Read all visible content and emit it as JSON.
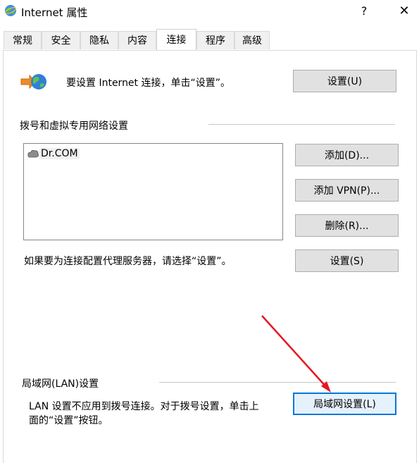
{
  "window": {
    "title": "Internet 属性",
    "help": "?",
    "close": "✕"
  },
  "tabs": [
    {
      "label": "常规"
    },
    {
      "label": "安全"
    },
    {
      "label": "隐私"
    },
    {
      "label": "内容"
    },
    {
      "label": "连接",
      "active": true
    },
    {
      "label": "程序"
    },
    {
      "label": "高级"
    }
  ],
  "setup": {
    "text": "要设置 Internet 连接，单击“设置”。",
    "button": "设置(U)"
  },
  "dialup": {
    "heading": "拨号和虚拟专用网络设置",
    "items": [
      {
        "name": "Dr.COM"
      }
    ],
    "add": "添加(D)...",
    "add_vpn": "添加 VPN(P)...",
    "remove": "删除(R)...",
    "proxy_text": "如果要为连接配置代理服务器，请选择“设置”。",
    "settings": "设置(S)"
  },
  "lan": {
    "heading": "局域网(LAN)设置",
    "text_line1": "LAN 设置不应用到拨号连接。对于拨号设置，单击上",
    "text_line2": "面的“设置”按钮。",
    "button": "局域网设置(L)"
  },
  "colors": {
    "accent": "#0078d7",
    "annotation_arrow": "#e5171f"
  },
  "icons": {
    "app": "globe-icon",
    "setup": "network-wizard-icon",
    "dialup_item": "dialup-connection-icon"
  }
}
